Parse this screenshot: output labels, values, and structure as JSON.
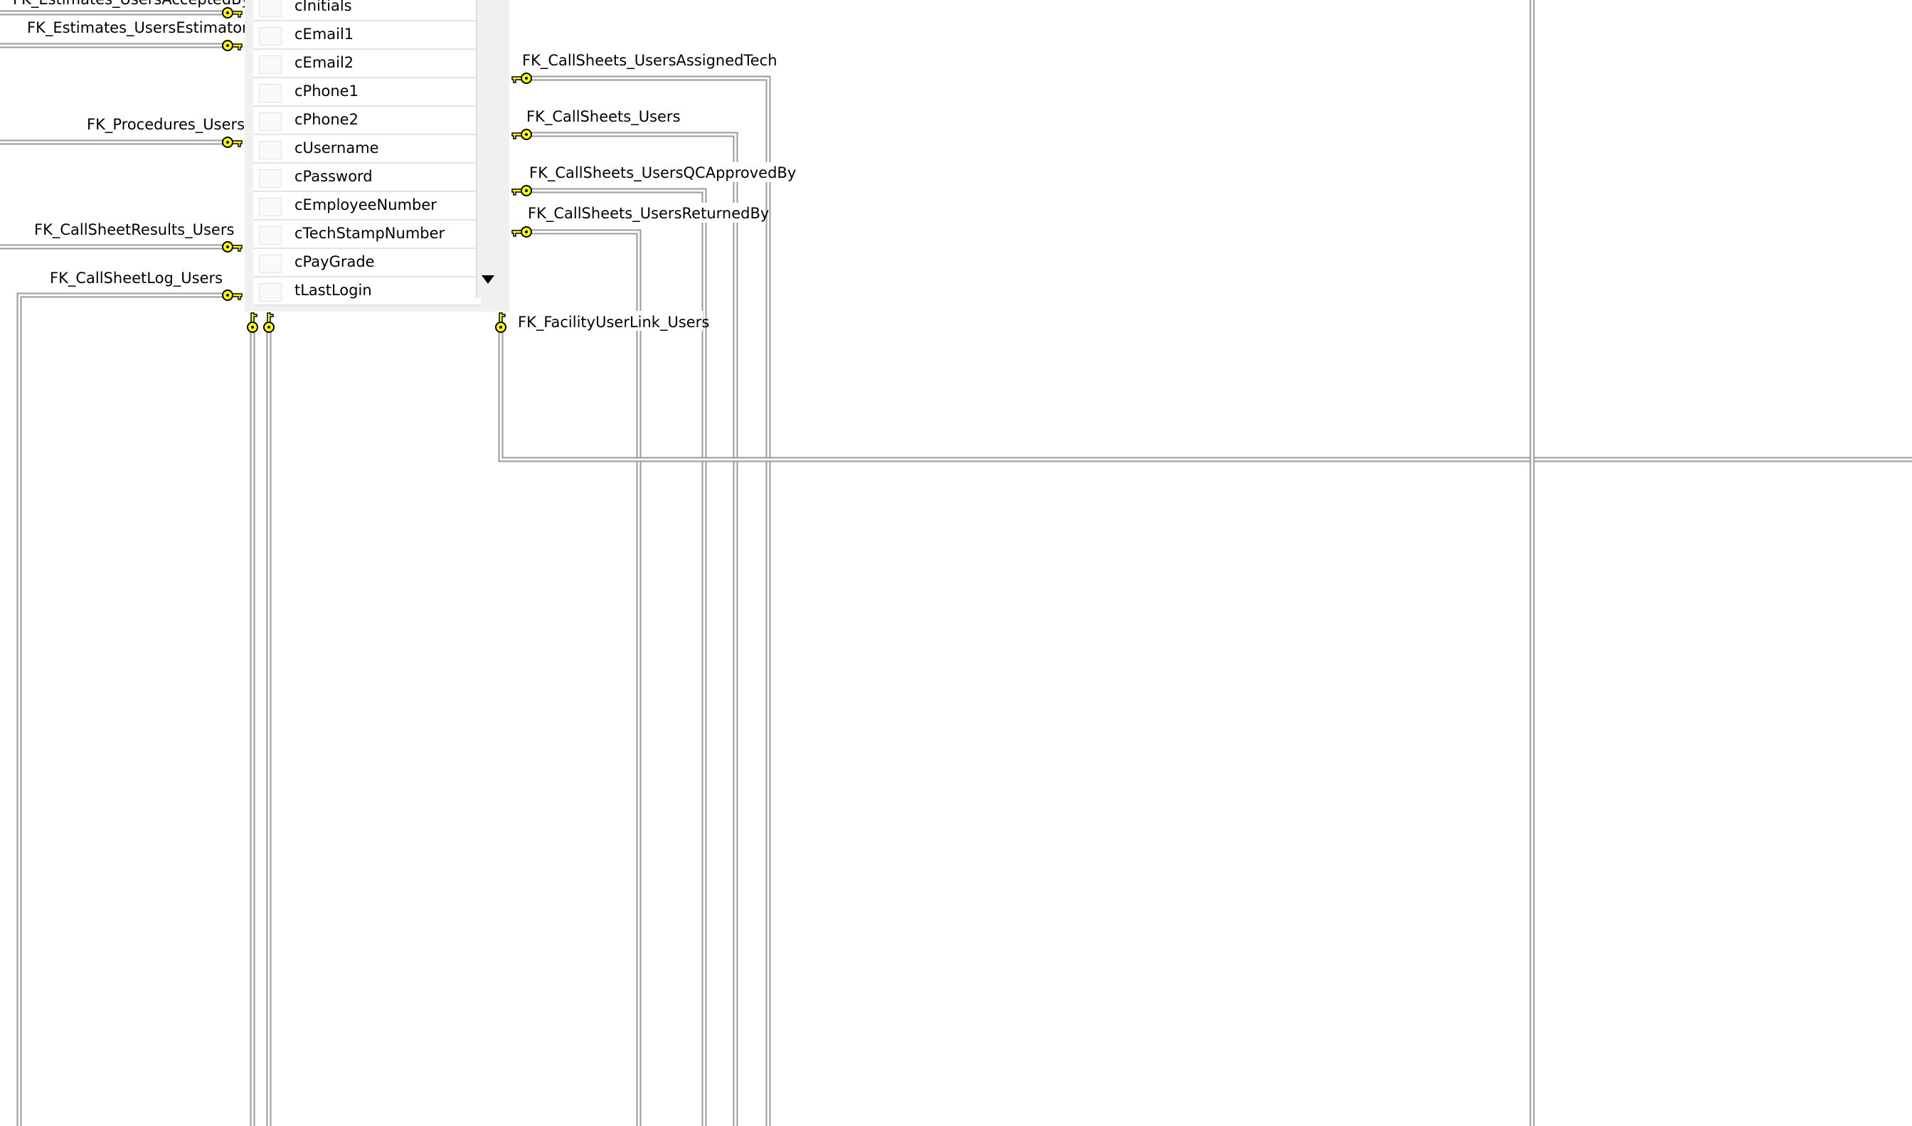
{
  "table": {
    "columns": [
      "cInitials",
      "cEmail1",
      "cEmail2",
      "cPhone1",
      "cPhone2",
      "cUsername",
      "cPassword",
      "cEmployeeNumber",
      "cTechStampNumber",
      "cPayGrade",
      "tLastLogin"
    ]
  },
  "relationships": {
    "left": [
      "FK_Estimates_UsersAcceptedBy",
      "FK_Estimates_UsersEstimator",
      "FK_Procedures_Users",
      "FK_CallSheetResults_Users",
      "FK_CallSheetLog_Users"
    ],
    "right": [
      "FK_CallSheets_UsersAssignedTech",
      "FK_CallSheets_Users",
      "FK_CallSheets_UsersQCApprovedBy",
      "FK_CallSheets_UsersReturnedBy"
    ],
    "bottom": "FK_FacilityUserLink_Users"
  },
  "colors": {
    "key_fill": "#ffff00",
    "key_stroke": "#000000",
    "wire": "#9a9a9a",
    "table_bg": "#f0f0f0"
  },
  "icons": {
    "relationship_end": "key-icon",
    "scroll": "scroll-down-arrow-icon"
  }
}
